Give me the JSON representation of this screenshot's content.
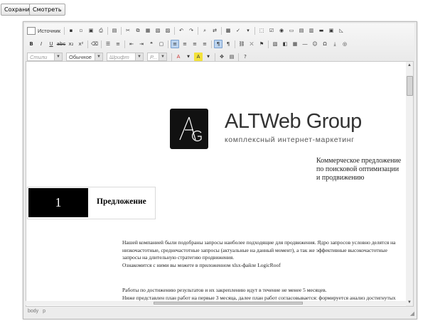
{
  "buttons": {
    "save": "Сохранить",
    "view": "Смотреть"
  },
  "toolbar": {
    "source_label": "Источник",
    "styles_placeholder": "Стили",
    "format_value": "Обычное",
    "font_placeholder": "Шрифт",
    "size_placeholder": "Р..."
  },
  "document": {
    "brand_name": "ALTWeb Group",
    "brand_tagline": "комплексный интернет-маркетинг",
    "offer_lines": [
      "Коммерческое предложение",
      "по поисковой оптимизации",
      "и продвижению"
    ],
    "section_number": "1",
    "section_title": "Предложение",
    "paragraph1": [
      "Нашей компанией были подобраны запросы наиболее подходящие для продвижения. Ядро запросов условно делятся на",
      "низкочастотные, среднечастотные запросы (актуальные на данный момент), а так же эффективные высокочастотные",
      "запросы на длительную стратегию продвижения.",
      "Ознакомится с ними вы можете в приложенном xlsx-файле LogicRoof"
    ],
    "paragraph2": [
      "Работы по достижению результатов и их закреплению идут в течение не менее 5 месяцев.",
      "Ниже представлен план работ на первые 3 месяца, далее план работ согласовывается: формируется анализ достигнутых"
    ]
  },
  "statusbar": {
    "path": [
      "body",
      "p"
    ]
  }
}
